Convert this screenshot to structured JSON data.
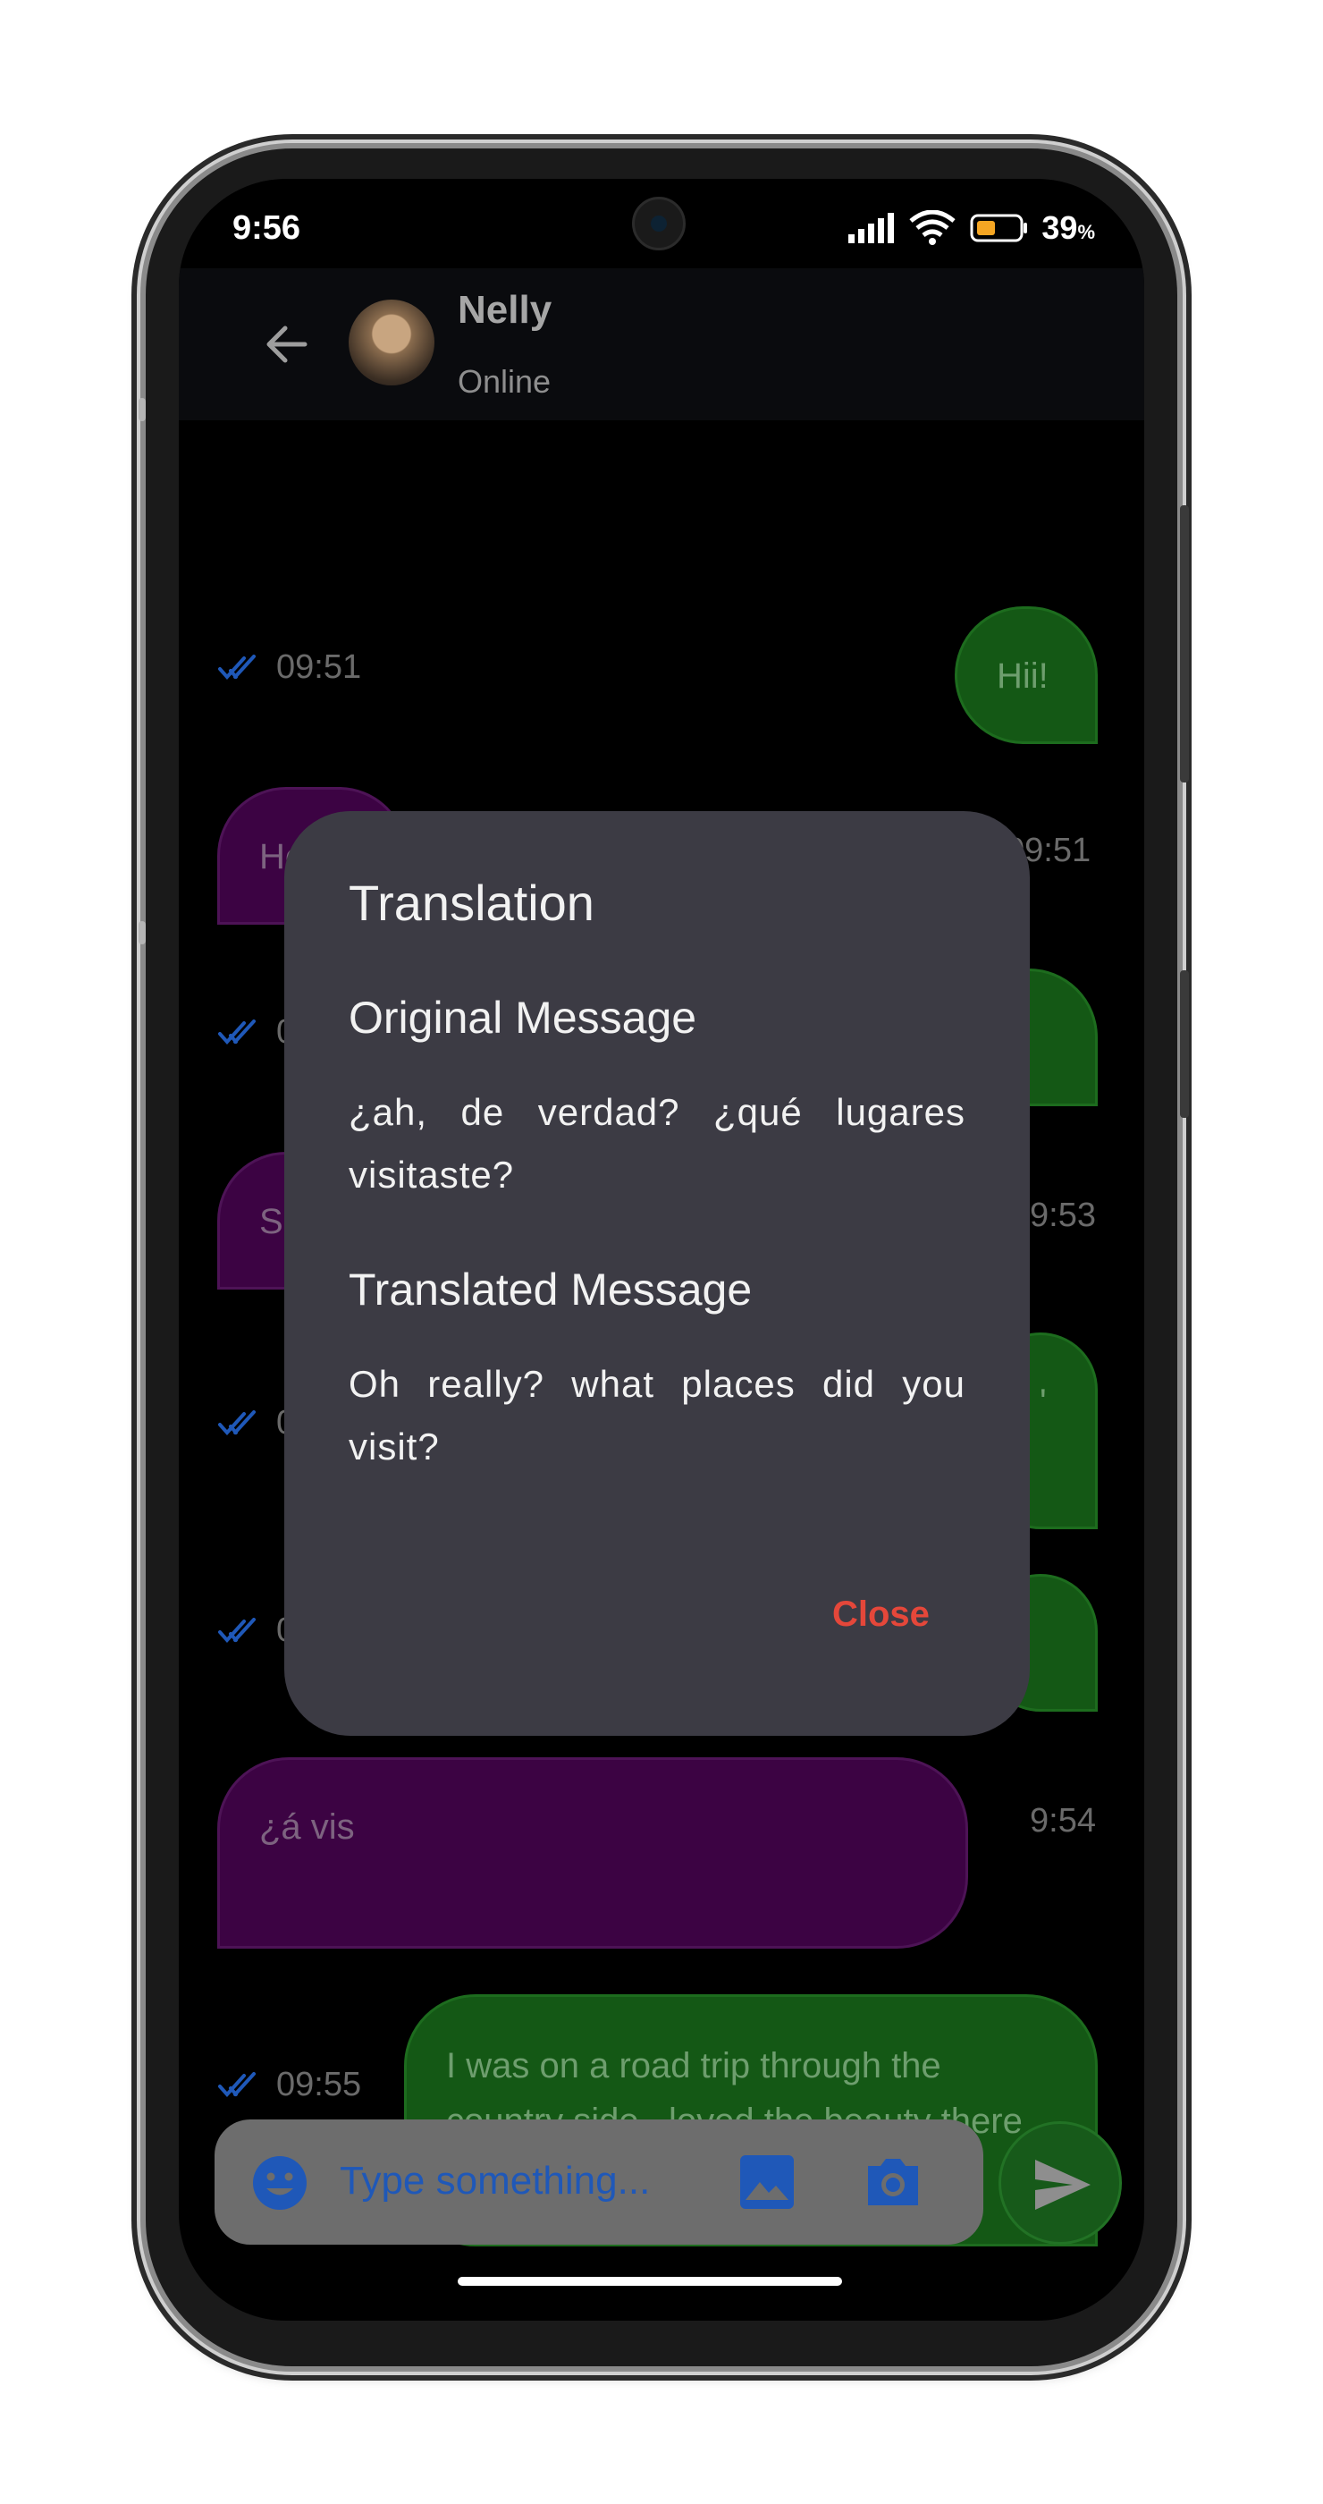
{
  "status_bar": {
    "time": "9:56",
    "battery_percent": "39",
    "battery_unit": "%"
  },
  "header": {
    "contact_name": "Nelly",
    "contact_status": "Online"
  },
  "messages": [
    {
      "direction": "out",
      "text": "Hii!",
      "time": "09:51"
    },
    {
      "direction": "in",
      "text": "Hola!!",
      "time": "09:51"
    },
    {
      "direction": "out",
      "text": "n?",
      "time": "0"
    },
    {
      "direction": "in",
      "text": "S",
      "time": "9:53"
    },
    {
      "direction": "out",
      "text": "'",
      "time": "0"
    },
    {
      "direction": "out",
      "text": "",
      "time": "0"
    },
    {
      "direction": "in",
      "text": "¿á vis",
      "time": "9:54"
    },
    {
      "direction": "out",
      "text": "I was on a road trip through the country side...loved the beauty there",
      "time": "09:55"
    }
  ],
  "input": {
    "placeholder": "Type something..."
  },
  "dialog": {
    "title": "Translation",
    "original_heading": "Original Message",
    "original_text": "¿ah, de verdad? ¿qué lugares visitaste?",
    "translated_heading": "Translated Message",
    "translated_text": "Oh really? what places did you visit?",
    "close_label": "Close"
  },
  "colors": {
    "outgoing_bubble": "#145815",
    "incoming_bubble": "#3c0343",
    "dialog_bg": "#3c3b44",
    "close_text": "#e5473a",
    "read_ticks": "#1f58b8"
  }
}
